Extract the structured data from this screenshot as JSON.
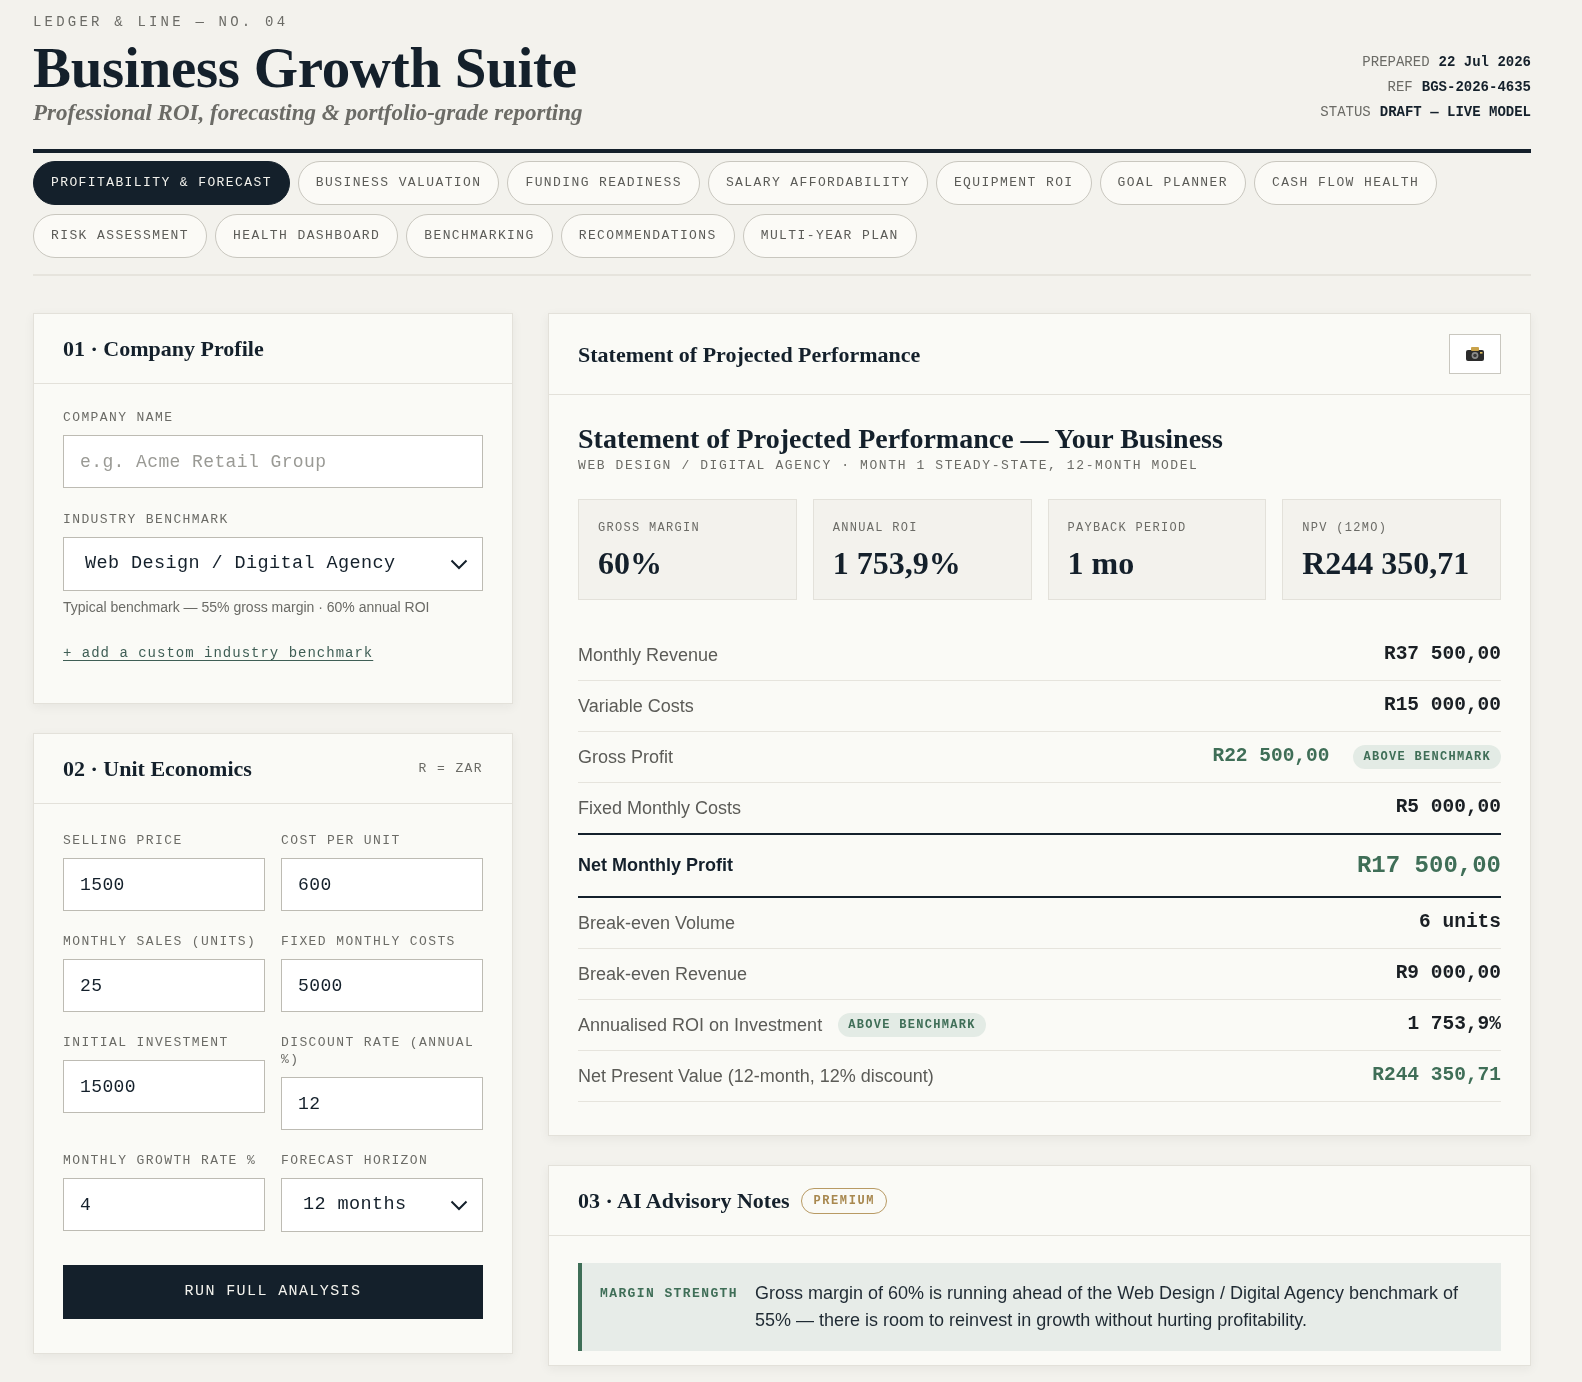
{
  "header": {
    "kicker": "LEDGER & LINE — NO. 04",
    "title": "Business Growth Suite",
    "subtitle": "Professional ROI, forecasting & portfolio-grade reporting",
    "meta": [
      {
        "label": "PREPARED",
        "value": "22 Jul 2026"
      },
      {
        "label": "REF",
        "value": "BGS-2026-4635"
      },
      {
        "label": "STATUS",
        "value": "DRAFT — LIVE MODEL"
      }
    ]
  },
  "tabs": [
    {
      "label": "PROFITABILITY & FORECAST",
      "selected": true
    },
    {
      "label": "BUSINESS VALUATION",
      "selected": false
    },
    {
      "label": "FUNDING READINESS",
      "selected": false
    },
    {
      "label": "SALARY AFFORDABILITY",
      "selected": false
    },
    {
      "label": "EQUIPMENT ROI",
      "selected": false
    },
    {
      "label": "GOAL PLANNER",
      "selected": false
    },
    {
      "label": "CASH FLOW HEALTH",
      "selected": false
    },
    {
      "label": "RISK ASSESSMENT",
      "selected": false
    },
    {
      "label": "HEALTH DASHBOARD",
      "selected": false
    },
    {
      "label": "BENCHMARKING",
      "selected": false
    },
    {
      "label": "RECOMMENDATIONS",
      "selected": false
    },
    {
      "label": "MULTI-YEAR PLAN",
      "selected": false
    }
  ],
  "company_profile": {
    "title": "01 · Company Profile",
    "fields": [
      {
        "kind": "text",
        "label": "COMPANY NAME",
        "placeholder": "e.g. Acme Retail Group"
      },
      {
        "kind": "select",
        "label": "INDUSTRY BENCHMARK",
        "value": "Web Design / Digital Agency",
        "hint": "Typical benchmark — 55% gross margin · 60% annual ROI"
      }
    ],
    "link": "+ add a custom industry benchmark"
  },
  "unit_economics": {
    "title": "02 · Unit Economics",
    "currency_note": "R = ZAR",
    "fields": [
      {
        "kind": "text",
        "label": "SELLING PRICE",
        "value": "1500"
      },
      {
        "kind": "text",
        "label": "COST PER UNIT",
        "value": "600"
      },
      {
        "kind": "text",
        "label": "MONTHLY SALES (UNITS)",
        "value": "25"
      },
      {
        "kind": "text",
        "label": "FIXED MONTHLY COSTS",
        "value": "5000"
      },
      {
        "kind": "text",
        "label": "INITIAL INVESTMENT",
        "value": "15000"
      },
      {
        "kind": "text",
        "label": "DISCOUNT RATE (ANNUAL %)",
        "value": "12"
      },
      {
        "kind": "text",
        "label": "MONTHLY GROWTH RATE %",
        "value": "4"
      },
      {
        "kind": "select",
        "label": "FORECAST HORIZON",
        "value": "12 months"
      }
    ],
    "button": "RUN FULL ANALYSIS"
  },
  "statement": {
    "title": "Statement of Projected Performance",
    "report_title": "Statement of Projected Performance — Your Business",
    "report_subtitle": "WEB DESIGN / DIGITAL AGENCY · MONTH 1 STEADY-STATE, 12-MONTH MODEL",
    "metrics": [
      {
        "label": "GROSS MARGIN",
        "value": "60%"
      },
      {
        "label": "ANNUAL ROI",
        "value": "1 753,9%"
      },
      {
        "label": "PAYBACK PERIOD",
        "value": "1 mo"
      },
      {
        "label": "NPV (12MO)",
        "value": "R244 350,71"
      }
    ],
    "rows": [
      {
        "kind": "line",
        "label": "Monthly Revenue",
        "value": "R37 500,00",
        "positive": false
      },
      {
        "kind": "line",
        "label": "Variable Costs",
        "value": "R15 000,00",
        "positive": false
      },
      {
        "kind": "line",
        "label": "Gross Profit",
        "value": "R22 500,00",
        "positive": true,
        "value_badge": "ABOVE BENCHMARK"
      },
      {
        "kind": "line",
        "label": "Fixed Monthly Costs",
        "value": "R5 000,00",
        "positive": false
      },
      {
        "kind": "total",
        "label": "Net Monthly Profit",
        "value": "R17 500,00",
        "positive": true
      },
      {
        "kind": "line",
        "label": "Break-even Volume",
        "value": "6 units",
        "positive": false
      },
      {
        "kind": "line",
        "label": "Break-even Revenue",
        "value": "R9 000,00",
        "positive": false
      },
      {
        "kind": "line",
        "label": "Annualised ROI on Investment",
        "label_badge": "ABOVE BENCHMARK",
        "value": "1 753,9%",
        "positive": false
      },
      {
        "kind": "line",
        "label": "Net Present Value (12-month, 12% discount)",
        "value": "R244 350,71",
        "positive": true
      }
    ]
  },
  "advisory": {
    "title": "03 · AI Advisory Notes",
    "badge": "PREMIUM",
    "notes": [
      {
        "tag": "MARGIN STRENGTH",
        "text": "Gross margin of 60% is running ahead of the Web Design / Digital Agency benchmark of 55% — there is room to reinvest in growth without hurting profitability."
      }
    ]
  }
}
